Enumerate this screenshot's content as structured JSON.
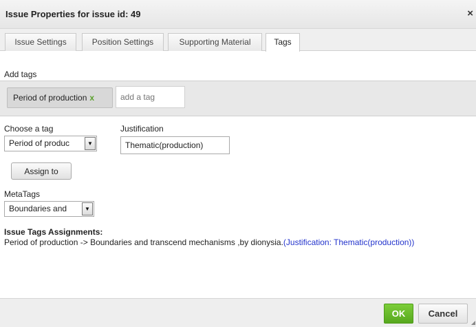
{
  "dialog": {
    "title": "Issue Properties for issue id: 49",
    "close_icon": "close-icon",
    "close_glyph": "×"
  },
  "tabs": [
    {
      "label": "Issue Settings",
      "active": false
    },
    {
      "label": "Position Settings",
      "active": false
    },
    {
      "label": "Supporting Material",
      "active": false
    },
    {
      "label": "Tags",
      "active": true
    }
  ],
  "add_tags": {
    "label": "Add tags",
    "tags": [
      {
        "label": "Period of production",
        "remove": "x"
      }
    ],
    "input_placeholder": "add a tag"
  },
  "choose_tag": {
    "label": "Choose a tag",
    "selected": "Period of produc"
  },
  "justification": {
    "label": "Justification",
    "value": "Thematic(production)"
  },
  "assign_button": "Assign to",
  "metatags": {
    "label": "MetaTags",
    "selected": "Boundaries and"
  },
  "assignments": {
    "title": "Issue Tags Assignments:",
    "text": "Period of production -> Boundaries and transcend mechanisms ,by dionysia.",
    "justification": "(Justification: Thematic(production))"
  },
  "footer": {
    "ok_label": "OK",
    "cancel_label": "Cancel"
  },
  "colors": {
    "ok_green": "#5aa82a",
    "remove_x_green": "#5aa02c",
    "justification_blue": "#2233cc"
  }
}
